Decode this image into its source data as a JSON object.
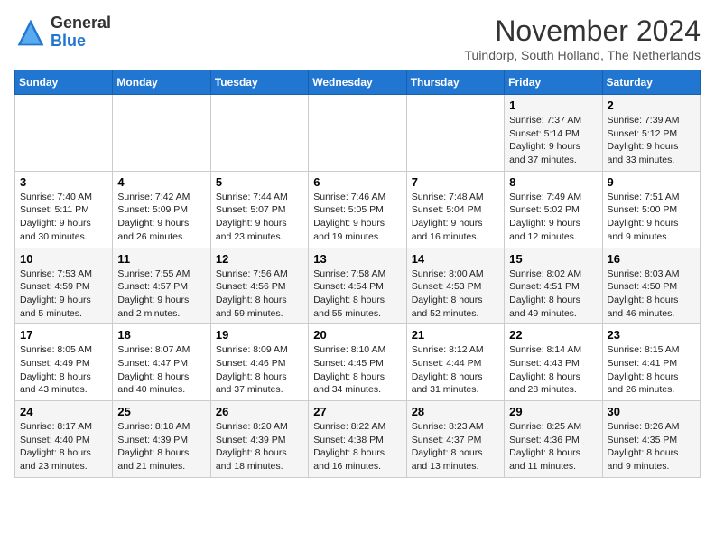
{
  "header": {
    "logo_general": "General",
    "logo_blue": "Blue",
    "month_title": "November 2024",
    "location": "Tuindorp, South Holland, The Netherlands"
  },
  "weekdays": [
    "Sunday",
    "Monday",
    "Tuesday",
    "Wednesday",
    "Thursday",
    "Friday",
    "Saturday"
  ],
  "weeks": [
    [
      {
        "day": "",
        "sunrise": "",
        "sunset": "",
        "daylight": ""
      },
      {
        "day": "",
        "sunrise": "",
        "sunset": "",
        "daylight": ""
      },
      {
        "day": "",
        "sunrise": "",
        "sunset": "",
        "daylight": ""
      },
      {
        "day": "",
        "sunrise": "",
        "sunset": "",
        "daylight": ""
      },
      {
        "day": "",
        "sunrise": "",
        "sunset": "",
        "daylight": ""
      },
      {
        "day": "1",
        "sunrise": "Sunrise: 7:37 AM",
        "sunset": "Sunset: 5:14 PM",
        "daylight": "Daylight: 9 hours and 37 minutes."
      },
      {
        "day": "2",
        "sunrise": "Sunrise: 7:39 AM",
        "sunset": "Sunset: 5:12 PM",
        "daylight": "Daylight: 9 hours and 33 minutes."
      }
    ],
    [
      {
        "day": "3",
        "sunrise": "Sunrise: 7:40 AM",
        "sunset": "Sunset: 5:11 PM",
        "daylight": "Daylight: 9 hours and 30 minutes."
      },
      {
        "day": "4",
        "sunrise": "Sunrise: 7:42 AM",
        "sunset": "Sunset: 5:09 PM",
        "daylight": "Daylight: 9 hours and 26 minutes."
      },
      {
        "day": "5",
        "sunrise": "Sunrise: 7:44 AM",
        "sunset": "Sunset: 5:07 PM",
        "daylight": "Daylight: 9 hours and 23 minutes."
      },
      {
        "day": "6",
        "sunrise": "Sunrise: 7:46 AM",
        "sunset": "Sunset: 5:05 PM",
        "daylight": "Daylight: 9 hours and 19 minutes."
      },
      {
        "day": "7",
        "sunrise": "Sunrise: 7:48 AM",
        "sunset": "Sunset: 5:04 PM",
        "daylight": "Daylight: 9 hours and 16 minutes."
      },
      {
        "day": "8",
        "sunrise": "Sunrise: 7:49 AM",
        "sunset": "Sunset: 5:02 PM",
        "daylight": "Daylight: 9 hours and 12 minutes."
      },
      {
        "day": "9",
        "sunrise": "Sunrise: 7:51 AM",
        "sunset": "Sunset: 5:00 PM",
        "daylight": "Daylight: 9 hours and 9 minutes."
      }
    ],
    [
      {
        "day": "10",
        "sunrise": "Sunrise: 7:53 AM",
        "sunset": "Sunset: 4:59 PM",
        "daylight": "Daylight: 9 hours and 5 minutes."
      },
      {
        "day": "11",
        "sunrise": "Sunrise: 7:55 AM",
        "sunset": "Sunset: 4:57 PM",
        "daylight": "Daylight: 9 hours and 2 minutes."
      },
      {
        "day": "12",
        "sunrise": "Sunrise: 7:56 AM",
        "sunset": "Sunset: 4:56 PM",
        "daylight": "Daylight: 8 hours and 59 minutes."
      },
      {
        "day": "13",
        "sunrise": "Sunrise: 7:58 AM",
        "sunset": "Sunset: 4:54 PM",
        "daylight": "Daylight: 8 hours and 55 minutes."
      },
      {
        "day": "14",
        "sunrise": "Sunrise: 8:00 AM",
        "sunset": "Sunset: 4:53 PM",
        "daylight": "Daylight: 8 hours and 52 minutes."
      },
      {
        "day": "15",
        "sunrise": "Sunrise: 8:02 AM",
        "sunset": "Sunset: 4:51 PM",
        "daylight": "Daylight: 8 hours and 49 minutes."
      },
      {
        "day": "16",
        "sunrise": "Sunrise: 8:03 AM",
        "sunset": "Sunset: 4:50 PM",
        "daylight": "Daylight: 8 hours and 46 minutes."
      }
    ],
    [
      {
        "day": "17",
        "sunrise": "Sunrise: 8:05 AM",
        "sunset": "Sunset: 4:49 PM",
        "daylight": "Daylight: 8 hours and 43 minutes."
      },
      {
        "day": "18",
        "sunrise": "Sunrise: 8:07 AM",
        "sunset": "Sunset: 4:47 PM",
        "daylight": "Daylight: 8 hours and 40 minutes."
      },
      {
        "day": "19",
        "sunrise": "Sunrise: 8:09 AM",
        "sunset": "Sunset: 4:46 PM",
        "daylight": "Daylight: 8 hours and 37 minutes."
      },
      {
        "day": "20",
        "sunrise": "Sunrise: 8:10 AM",
        "sunset": "Sunset: 4:45 PM",
        "daylight": "Daylight: 8 hours and 34 minutes."
      },
      {
        "day": "21",
        "sunrise": "Sunrise: 8:12 AM",
        "sunset": "Sunset: 4:44 PM",
        "daylight": "Daylight: 8 hours and 31 minutes."
      },
      {
        "day": "22",
        "sunrise": "Sunrise: 8:14 AM",
        "sunset": "Sunset: 4:43 PM",
        "daylight": "Daylight: 8 hours and 28 minutes."
      },
      {
        "day": "23",
        "sunrise": "Sunrise: 8:15 AM",
        "sunset": "Sunset: 4:41 PM",
        "daylight": "Daylight: 8 hours and 26 minutes."
      }
    ],
    [
      {
        "day": "24",
        "sunrise": "Sunrise: 8:17 AM",
        "sunset": "Sunset: 4:40 PM",
        "daylight": "Daylight: 8 hours and 23 minutes."
      },
      {
        "day": "25",
        "sunrise": "Sunrise: 8:18 AM",
        "sunset": "Sunset: 4:39 PM",
        "daylight": "Daylight: 8 hours and 21 minutes."
      },
      {
        "day": "26",
        "sunrise": "Sunrise: 8:20 AM",
        "sunset": "Sunset: 4:39 PM",
        "daylight": "Daylight: 8 hours and 18 minutes."
      },
      {
        "day": "27",
        "sunrise": "Sunrise: 8:22 AM",
        "sunset": "Sunset: 4:38 PM",
        "daylight": "Daylight: 8 hours and 16 minutes."
      },
      {
        "day": "28",
        "sunrise": "Sunrise: 8:23 AM",
        "sunset": "Sunset: 4:37 PM",
        "daylight": "Daylight: 8 hours and 13 minutes."
      },
      {
        "day": "29",
        "sunrise": "Sunrise: 8:25 AM",
        "sunset": "Sunset: 4:36 PM",
        "daylight": "Daylight: 8 hours and 11 minutes."
      },
      {
        "day": "30",
        "sunrise": "Sunrise: 8:26 AM",
        "sunset": "Sunset: 4:35 PM",
        "daylight": "Daylight: 8 hours and 9 minutes."
      }
    ]
  ]
}
